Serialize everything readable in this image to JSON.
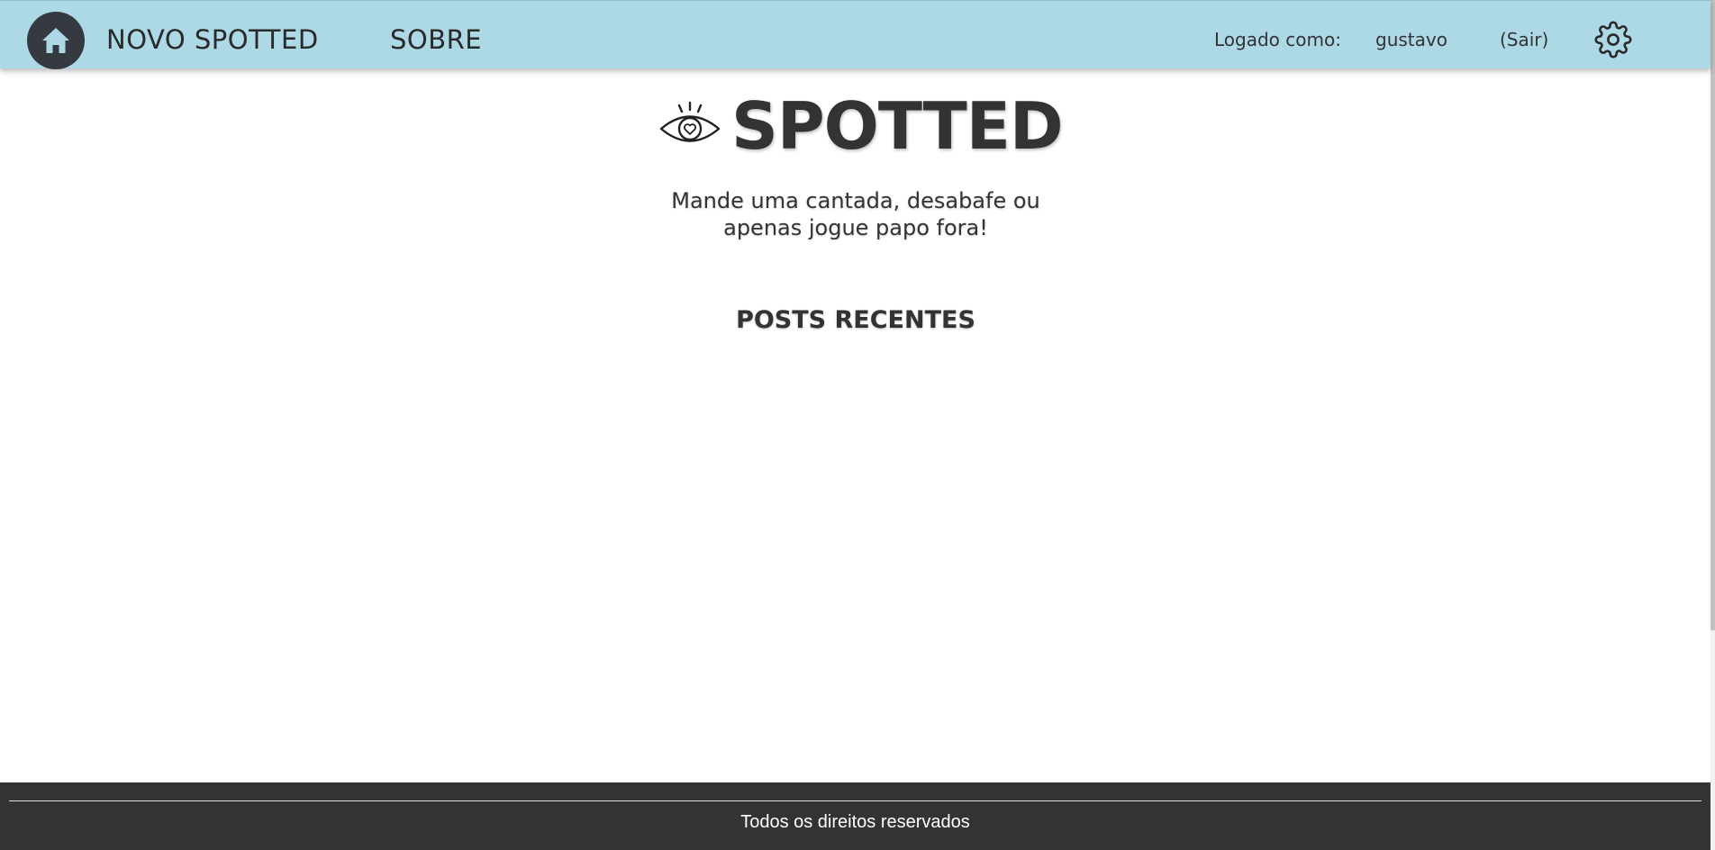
{
  "nav": {
    "home_icon": "home-icon",
    "new_spotted": "NOVO SPOTTED",
    "about": "SOBRE",
    "logged_in_label": "Logado como:",
    "username": "gustavo",
    "logout": "(Sair)",
    "settings_icon": "gear-icon"
  },
  "hero": {
    "logo_icon": "eye-heart-icon",
    "title": "SPOTTED",
    "tagline_line1": "Mande uma cantada, desabafe ou",
    "tagline_line2": "apenas jogue papo fora!"
  },
  "posts": {
    "heading": "POSTS RECENTES",
    "items": []
  },
  "footer": {
    "copyright": "Todos os direitos reservados"
  },
  "colors": {
    "header_bg": "#add8e6",
    "home_button_bg": "#343a40",
    "text": "#333333",
    "footer_bg": "#333333",
    "footer_text": "#ffffff"
  }
}
